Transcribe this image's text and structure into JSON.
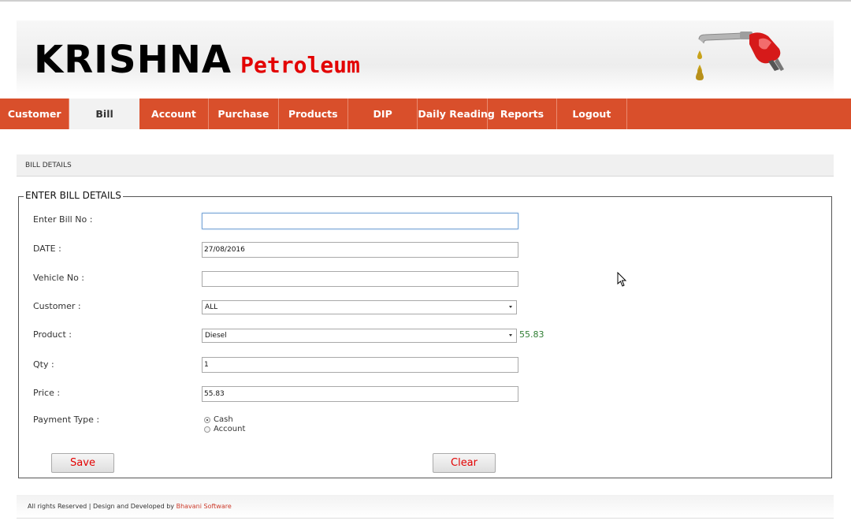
{
  "header": {
    "brand": "KRISHNA",
    "brand_sub": "Petroleum"
  },
  "nav": {
    "items": [
      "Customer",
      "Bill",
      "Account",
      "Purchase",
      "Products",
      "DIP",
      "Daily Reading",
      "Reports",
      "Logout"
    ],
    "active": "Bill"
  },
  "section": {
    "title": "BILL DETAILS"
  },
  "form": {
    "legend": "ENTER BILL DETAILS",
    "bill_no": {
      "label": "Enter Bill No :",
      "value": ""
    },
    "date": {
      "label": "DATE :",
      "value": "27/08/2016"
    },
    "vehicle_no": {
      "label": "Vehicle No :",
      "value": ""
    },
    "customer": {
      "label": "Customer :",
      "selected": "ALL"
    },
    "product": {
      "label": "Product :",
      "selected": "Diesel",
      "rate": "55.83"
    },
    "qty": {
      "label": "Qty :",
      "value": "1"
    },
    "price": {
      "label": "Price :",
      "value": "55.83"
    },
    "payment_type": {
      "label": "Payment Type :",
      "options": [
        "Cash",
        "Account"
      ],
      "selected": "Cash"
    },
    "save_label": "Save",
    "clear_label": "Clear"
  },
  "footer": {
    "text": "All rights Reserved | Design and Developed by ",
    "company": "Bhavani Software"
  },
  "colors": {
    "nav_bg": "#d94f2b",
    "brand_red": "#e30000",
    "rate_green": "#2e7d32"
  }
}
